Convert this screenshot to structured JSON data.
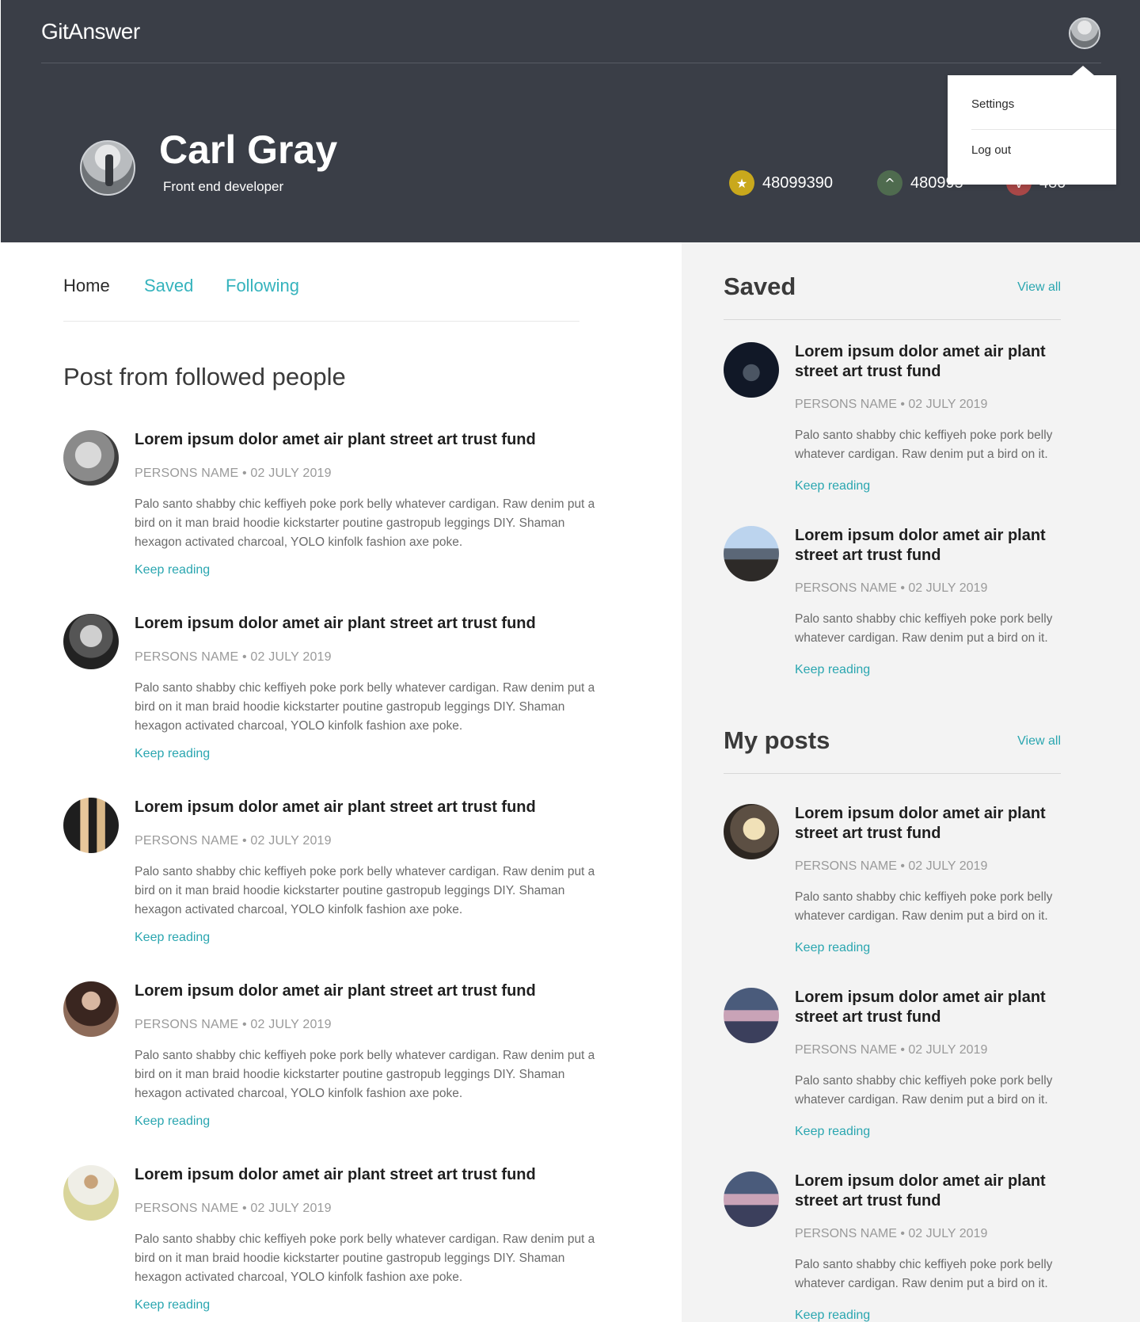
{
  "app": {
    "name": "GitAnswer"
  },
  "profile": {
    "name": "Carl Gray",
    "role": "Front end developer",
    "stats": [
      {
        "icon": "star-icon",
        "value": "48099390",
        "color": "#c9a81c"
      },
      {
        "icon": "chevron-up-icon",
        "value": "480995",
        "color": "#4f6b4f"
      },
      {
        "icon": "chevron-down-icon",
        "value": "480",
        "color": "#a84747"
      }
    ]
  },
  "menu": {
    "items": [
      "Settings",
      "Log out"
    ]
  },
  "tabs": [
    "Home",
    "Saved",
    "Following"
  ],
  "feed": {
    "title": "Post from followed people",
    "keep_label": "Keep reading",
    "posts": [
      {
        "title": "Lorem ipsum dolor amet air plant street art trust fund",
        "meta": "PERSONS NAME • 02 JULY 2019",
        "body": "Palo santo shabby chic keffiyeh poke pork belly whatever cardigan. Raw denim put a bird on it man braid hoodie kickstarter poutine gastropub leggings DIY. Shaman hexagon activated charcoal, YOLO kinfolk fashion axe poke."
      },
      {
        "title": "Lorem ipsum dolor amet air plant street art trust fund",
        "meta": "PERSONS NAME • 02 JULY 2019",
        "body": "Palo santo shabby chic keffiyeh poke pork belly whatever cardigan. Raw denim put a bird on it man braid hoodie kickstarter poutine gastropub leggings DIY. Shaman hexagon activated charcoal, YOLO kinfolk fashion axe poke."
      },
      {
        "title": "Lorem ipsum dolor amet air plant street art trust fund",
        "meta": "PERSONS NAME • 02 JULY 2019",
        "body": "Palo santo shabby chic keffiyeh poke pork belly whatever cardigan. Raw denim put a bird on it man braid hoodie kickstarter poutine gastropub leggings DIY. Shaman hexagon activated charcoal, YOLO kinfolk fashion axe poke."
      },
      {
        "title": "Lorem ipsum dolor amet air plant street art trust fund",
        "meta": "PERSONS NAME • 02 JULY 2019",
        "body": "Palo santo shabby chic keffiyeh poke pork belly whatever cardigan. Raw denim put a bird on it man braid hoodie kickstarter poutine gastropub leggings DIY. Shaman hexagon activated charcoal, YOLO kinfolk fashion axe poke."
      },
      {
        "title": "Lorem ipsum dolor amet air plant street art trust fund",
        "meta": "PERSONS NAME • 02 JULY 2019",
        "body": "Palo santo shabby chic keffiyeh poke pork belly whatever cardigan. Raw denim put a bird on it man braid hoodie kickstarter poutine gastropub leggings DIY. Shaman hexagon activated charcoal, YOLO kinfolk fashion axe poke."
      }
    ]
  },
  "saved": {
    "title": "Saved",
    "view_all": "View all",
    "keep_label": "Keep reading",
    "posts": [
      {
        "title": "Lorem ipsum dolor amet air plant street art trust fund",
        "meta": "PERSONS NAME • 02 JULY 2019",
        "body": "Palo santo shabby chic keffiyeh poke pork belly whatever cardigan. Raw denim put a bird on it."
      },
      {
        "title": "Lorem ipsum dolor amet air plant street art trust fund",
        "meta": "PERSONS NAME • 02 JULY 2019",
        "body": "Palo santo shabby chic keffiyeh poke pork belly whatever cardigan. Raw denim put a bird on it."
      }
    ]
  },
  "my_posts": {
    "title": "My posts",
    "view_all": "View all",
    "keep_label": "Keep reading",
    "posts": [
      {
        "title": "Lorem ipsum dolor amet air plant street art trust fund",
        "meta": "PERSONS NAME • 02 JULY 2019",
        "body": "Palo santo shabby chic keffiyeh poke pork belly whatever cardigan. Raw denim put a bird on it."
      },
      {
        "title": "Lorem ipsum dolor amet air plant street art trust fund",
        "meta": "PERSONS NAME • 02 JULY 2019",
        "body": "Palo santo shabby chic keffiyeh poke pork belly whatever cardigan. Raw denim put a bird on it."
      },
      {
        "title": "Lorem ipsum dolor amet air plant street art trust fund",
        "meta": "PERSONS NAME • 02 JULY 2019",
        "body": "Palo santo shabby chic keffiyeh poke pork belly whatever cardigan. Raw denim put a bird on it."
      }
    ]
  }
}
